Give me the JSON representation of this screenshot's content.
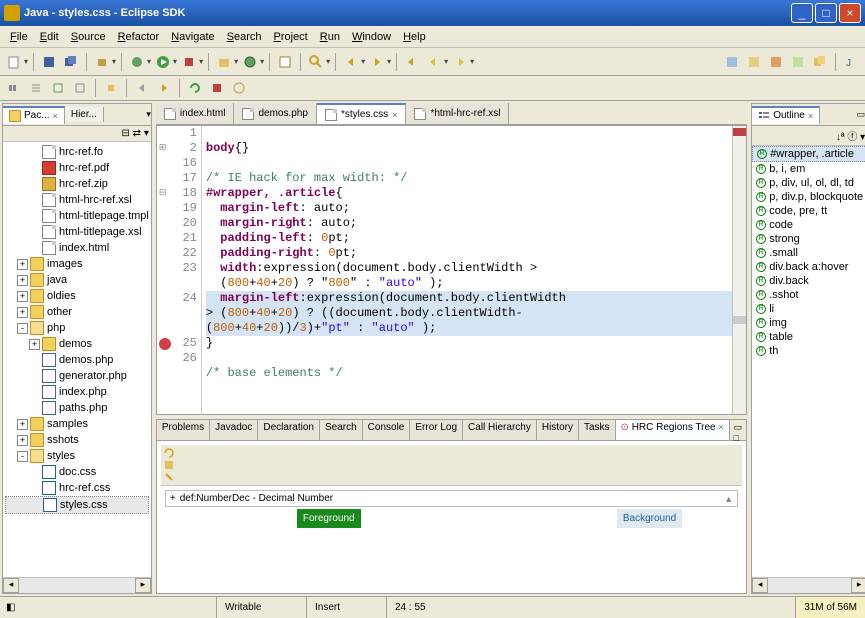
{
  "window": {
    "title": "Java - styles.css - Eclipse SDK"
  },
  "menu": [
    "File",
    "Edit",
    "Source",
    "Refactor",
    "Navigate",
    "Search",
    "Project",
    "Run",
    "Window",
    "Help"
  ],
  "left": {
    "tabs": [
      {
        "label": "Pac...",
        "active": true
      },
      {
        "label": "Hier..."
      }
    ],
    "tree": [
      {
        "ind": 2,
        "t": "file",
        "label": "hrc-ref.fo"
      },
      {
        "ind": 2,
        "t": "pdf",
        "label": "hrc-ref.pdf"
      },
      {
        "ind": 2,
        "t": "zip",
        "label": "hrc-ref.zip"
      },
      {
        "ind": 2,
        "t": "file",
        "label": "html-hrc-ref.xsl"
      },
      {
        "ind": 2,
        "t": "file",
        "label": "html-titlepage.tmpl"
      },
      {
        "ind": 2,
        "t": "file",
        "label": "html-titlepage.xsl"
      },
      {
        "ind": 2,
        "t": "file",
        "label": "index.html"
      },
      {
        "ind": 1,
        "t": "folder",
        "exp": "+",
        "label": "images"
      },
      {
        "ind": 1,
        "t": "folder",
        "exp": "+",
        "label": "java"
      },
      {
        "ind": 1,
        "t": "folder",
        "exp": "+",
        "label": "oldies"
      },
      {
        "ind": 1,
        "t": "folder",
        "exp": "+",
        "label": "other"
      },
      {
        "ind": 1,
        "t": "folder-open",
        "exp": "-",
        "label": "php"
      },
      {
        "ind": 2,
        "t": "folder",
        "exp": "+",
        "label": "demos"
      },
      {
        "ind": 2,
        "t": "php",
        "label": "demos.php"
      },
      {
        "ind": 2,
        "t": "php",
        "label": "generator.php"
      },
      {
        "ind": 2,
        "t": "php",
        "label": "index.php"
      },
      {
        "ind": 2,
        "t": "php",
        "label": "paths.php"
      },
      {
        "ind": 1,
        "t": "folder",
        "exp": "+",
        "label": "samples"
      },
      {
        "ind": 1,
        "t": "folder",
        "exp": "+",
        "label": "sshots"
      },
      {
        "ind": 1,
        "t": "folder-open",
        "exp": "-",
        "label": "styles"
      },
      {
        "ind": 2,
        "t": "css",
        "label": "doc.css"
      },
      {
        "ind": 2,
        "t": "css",
        "label": "hrc-ref.css"
      },
      {
        "ind": 2,
        "t": "css",
        "label": "styles.css",
        "sel": true
      }
    ]
  },
  "editor": {
    "tabs": [
      {
        "label": "index.html"
      },
      {
        "label": "demos.php"
      },
      {
        "label": "*styles.css",
        "active": true,
        "close": true
      },
      {
        "label": "*html-hrc-ref.xsl"
      }
    ],
    "lines": [
      {
        "n": "1",
        "c": ""
      },
      {
        "n": "2",
        "c": "body{}",
        "fold": "+"
      },
      {
        "n": "16",
        "c": ""
      },
      {
        "n": "17",
        "c": "/* IE hack for max width: */",
        "cls": "cmt"
      },
      {
        "n": "18",
        "c": "#wrapper, .article{",
        "kw": true,
        "fold": "-"
      },
      {
        "n": "19",
        "c": "  margin-left: auto;",
        "prop": true
      },
      {
        "n": "20",
        "c": "  margin-right: auto;",
        "prop": true
      },
      {
        "n": "21",
        "c": "  padding-left: 0pt;",
        "prop": true
      },
      {
        "n": "22",
        "c": "  padding-right: 0pt;",
        "prop": true
      },
      {
        "n": "23",
        "c": "  width:expression(document.body.clientWidth >",
        "prop": true
      },
      {
        "n": "",
        "c": "  (800+40+20) ? \"800\" : \"auto\" );"
      },
      {
        "n": "24",
        "c": "  margin-left:expression(document.body.clientWidth",
        "prop": true,
        "hl": true
      },
      {
        "n": "",
        "c": "> (800+40+20) ? ((document.body.clientWidth-",
        "hl": true
      },
      {
        "n": "",
        "c": "(800+40+20))/3)+\"pt\" : \"auto\" );",
        "hl": true
      },
      {
        "n": "25",
        "c": "}",
        "err": true
      },
      {
        "n": "26",
        "c": ""
      },
      {
        "n": "",
        "c": "/* base elements */",
        "cls": "cmt"
      }
    ]
  },
  "bottom": {
    "tabs": [
      "Problems",
      "Javadoc",
      "Declaration",
      "Search",
      "Console",
      "Error Log",
      "Call Hierarchy",
      "History",
      "Tasks"
    ],
    "active_tab": "HRC Regions Tree",
    "def_label": "def:NumberDec - Decimal Number",
    "fg": "Foreground",
    "bg": "Background"
  },
  "outline": {
    "title": "Outline",
    "items": [
      {
        "label": "#wrapper, .article",
        "sel": true
      },
      {
        "label": "b, i, em"
      },
      {
        "label": "p, div, ul, ol, dl, td"
      },
      {
        "label": "p, div.p, blockquote"
      },
      {
        "label": "code, pre, tt"
      },
      {
        "label": "code"
      },
      {
        "label": "strong"
      },
      {
        "label": ".small"
      },
      {
        "label": "div.back a:hover"
      },
      {
        "label": "div.back"
      },
      {
        "label": ".sshot"
      },
      {
        "label": "li"
      },
      {
        "label": "img"
      },
      {
        "label": "table"
      },
      {
        "label": "th"
      }
    ]
  },
  "status": {
    "writable": "Writable",
    "insert": "Insert",
    "pos": "24 : 55",
    "mem": "31M of 56M"
  }
}
